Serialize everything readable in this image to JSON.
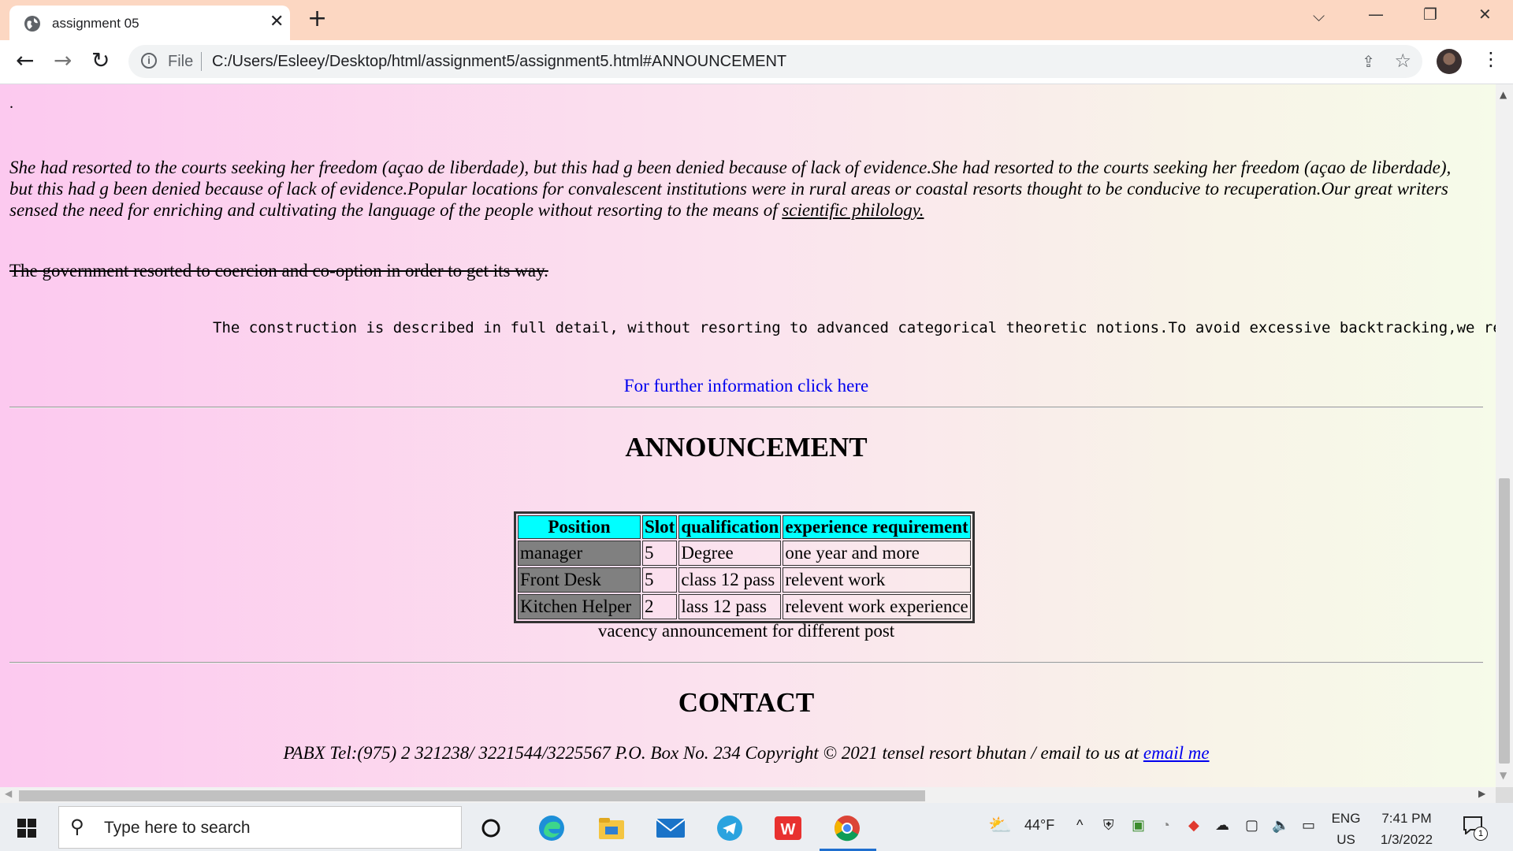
{
  "browser": {
    "tab_title": "assignment 05",
    "address_scheme": "File",
    "url": "C:/Users/Esleey/Desktop/html/assignment5/assignment5.html#ANNOUNCEMENT"
  },
  "page": {
    "stray_dot": ".",
    "paragraph_text": "She had resorted to the courts seeking her freedom (açao de liberdade), but this had g been denied because of lack of evidence.She had resorted to the courts seeking her freedom (açao de liberdade), but this had g been denied because of lack of evidence.Popular locations for convalescent institutions were in rural areas or coastal resorts thought to be conducive to recuperation.Our great writers sensed the need for enriching and cultivating the language of the people without resorting to the means of ",
    "paragraph_link": "scientific philology.",
    "strikethrough_text": "The government resorted to coercion and co-option in order to get its way",
    "strikethrough_tail": ".",
    "monospace_text": "The construction is described in full detail, without resorting to advanced categorical theoretic notions.To avoid excessive backtracking,we resorted to",
    "further_info_link": "For further information click here",
    "announcement_heading": "ANNOUNCEMENT",
    "table": {
      "headers": [
        "Position",
        "Slot",
        "qualification",
        "experience requirement"
      ],
      "rows": [
        [
          "manager",
          "5",
          "Degree",
          "one year and more"
        ],
        [
          "Front Desk",
          "5",
          "class 12 pass",
          "relevent work"
        ],
        [
          "Kitchen Helper",
          "2",
          "lass 12 pass",
          "relevent work experience"
        ]
      ],
      "caption": "vacency announcement for different post"
    },
    "contact_heading": "CONTACT",
    "footer_text": "PABX Tel:(975) 2 321238/ 3221544/3225567 P.O. Box No. 234 Copyright © 2021 tensel resort bhutan / email to us at ",
    "footer_link": "email me"
  },
  "taskbar": {
    "search_placeholder": "Type here to search",
    "weather_temp": "44°F",
    "language": "ENG",
    "region": "US",
    "time": "7:41 PM",
    "date": "1/3/2022",
    "notification_count": "1"
  },
  "colors": {
    "tabbar_bg": "#fcd7c2",
    "table_header_bg": "#00ffff",
    "position_cell_bg": "#808080",
    "link": "#0000ee"
  }
}
